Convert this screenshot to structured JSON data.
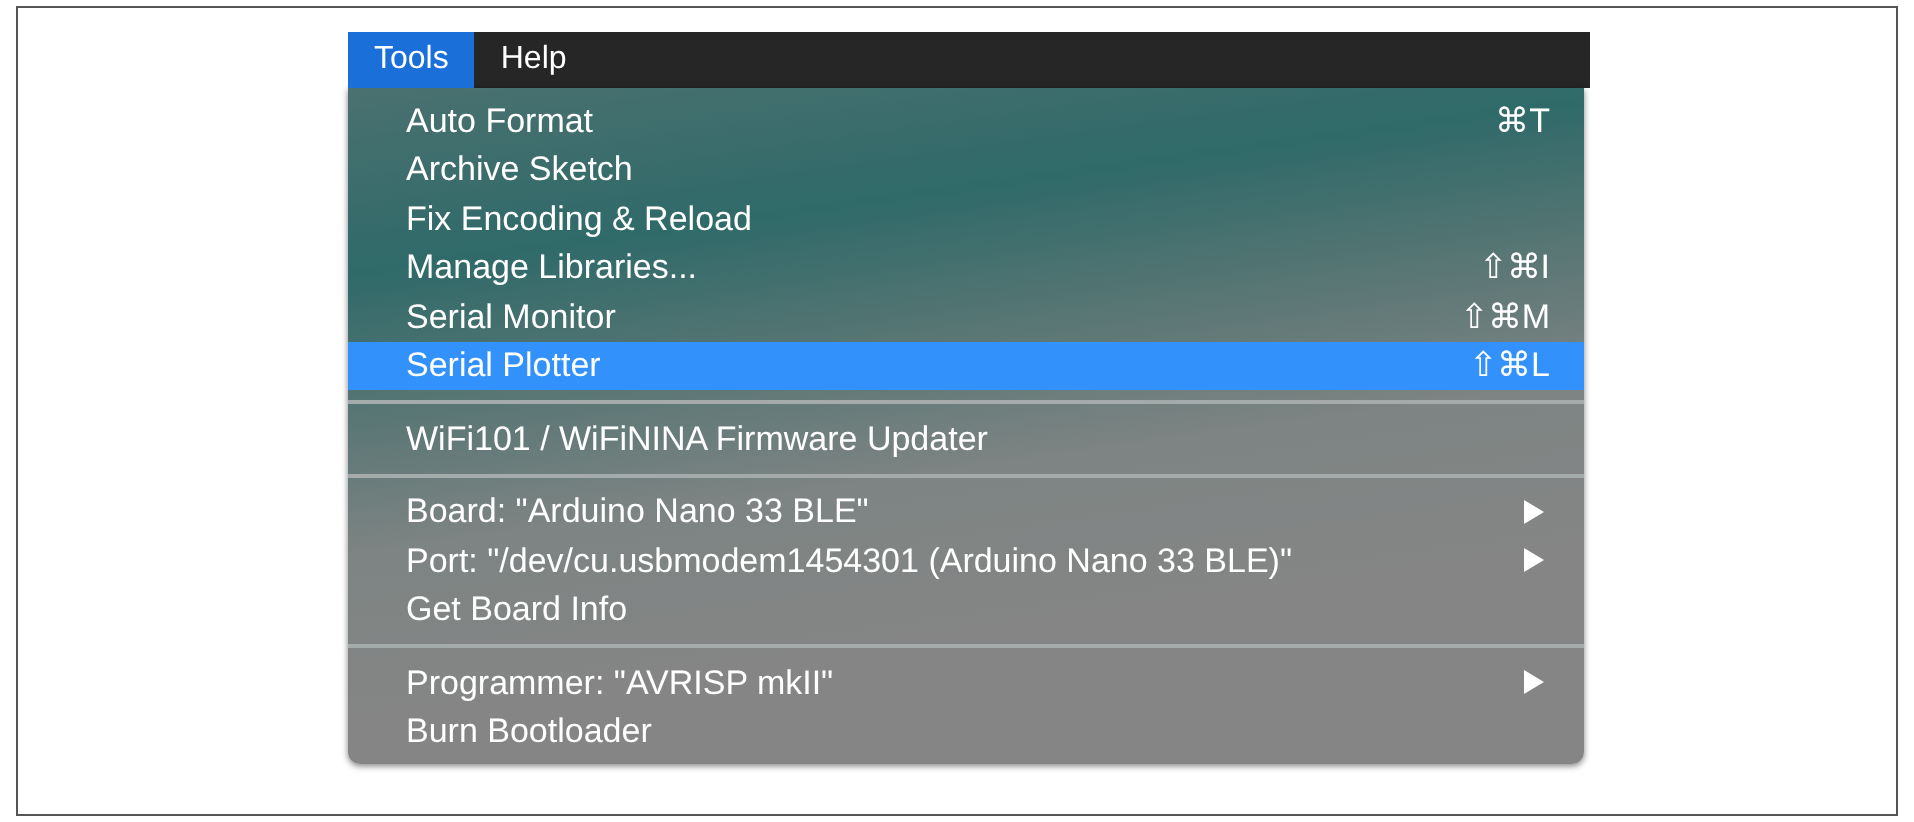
{
  "menu_bar": [
    {
      "label": "Tools",
      "selected": true
    },
    {
      "label": "Help",
      "selected": false
    }
  ],
  "menu": {
    "sections": [
      {
        "items": [
          {
            "label": "Auto Format",
            "shortcut": "⌘T",
            "submenu": false,
            "selected": false
          },
          {
            "label": "Archive Sketch",
            "submenu": false,
            "selected": false
          },
          {
            "label": "Fix Encoding & Reload",
            "submenu": false,
            "selected": false
          },
          {
            "label": "Manage Libraries...",
            "shortcut": "⇧⌘I",
            "submenu": false,
            "selected": false
          },
          {
            "label": "Serial Monitor",
            "shortcut": "⇧⌘M",
            "submenu": false,
            "selected": false
          },
          {
            "label": "Serial Plotter",
            "shortcut": "⇧⌘L",
            "submenu": false,
            "selected": true
          }
        ]
      },
      {
        "items": [
          {
            "label": "WiFi101 / WiFiNINA Firmware Updater",
            "submenu": false,
            "selected": false
          }
        ]
      },
      {
        "items": [
          {
            "label": "Board: \"Arduino Nano 33 BLE\"",
            "submenu": true,
            "selected": false
          },
          {
            "label": "Port: \"/dev/cu.usbmodem1454301 (Arduino Nano 33 BLE)\"",
            "submenu": true,
            "selected": false
          },
          {
            "label": "Get Board Info",
            "submenu": false,
            "selected": false
          }
        ]
      },
      {
        "items": [
          {
            "label": "Programmer: \"AVRISP mkII\"",
            "submenu": true,
            "selected": false
          },
          {
            "label": "Burn Bootloader",
            "submenu": false,
            "selected": false
          }
        ]
      }
    ]
  }
}
